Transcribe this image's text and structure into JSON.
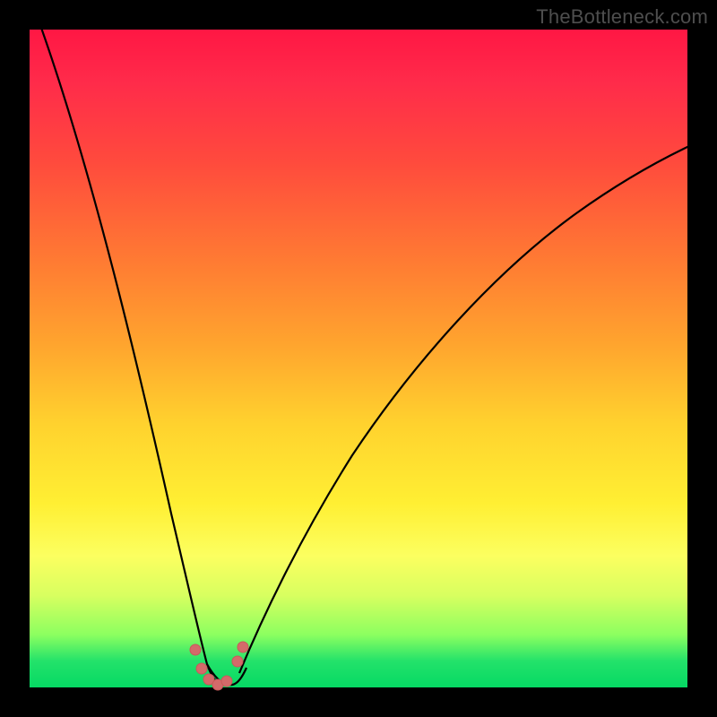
{
  "watermark": "TheBottleneck.com",
  "chart_data": {
    "type": "line",
    "title": "",
    "xlabel": "",
    "ylabel": "",
    "xlim": [
      0,
      1
    ],
    "ylim": [
      0,
      1
    ],
    "series": [
      {
        "name": "bottleneck-curve",
        "points_description": "asymmetric V-shaped curve, minimum near x≈0.28, left branch rises steeply to top-left corner, right branch rises more gradually toward top-right",
        "min_x": 0.28,
        "min_y": 0.0
      }
    ],
    "markers": [
      {
        "x": 0.252,
        "y": 0.058
      },
      {
        "x": 0.262,
        "y": 0.028
      },
      {
        "x": 0.272,
        "y": 0.012
      },
      {
        "x": 0.286,
        "y": 0.004
      },
      {
        "x": 0.3,
        "y": 0.01
      },
      {
        "x": 0.316,
        "y": 0.04
      },
      {
        "x": 0.324,
        "y": 0.062
      }
    ],
    "background_gradient": {
      "top": "#ff1744",
      "upper_mid": "#ffa52e",
      "lower_mid": "#fcff60",
      "bottom": "#06d964"
    }
  }
}
